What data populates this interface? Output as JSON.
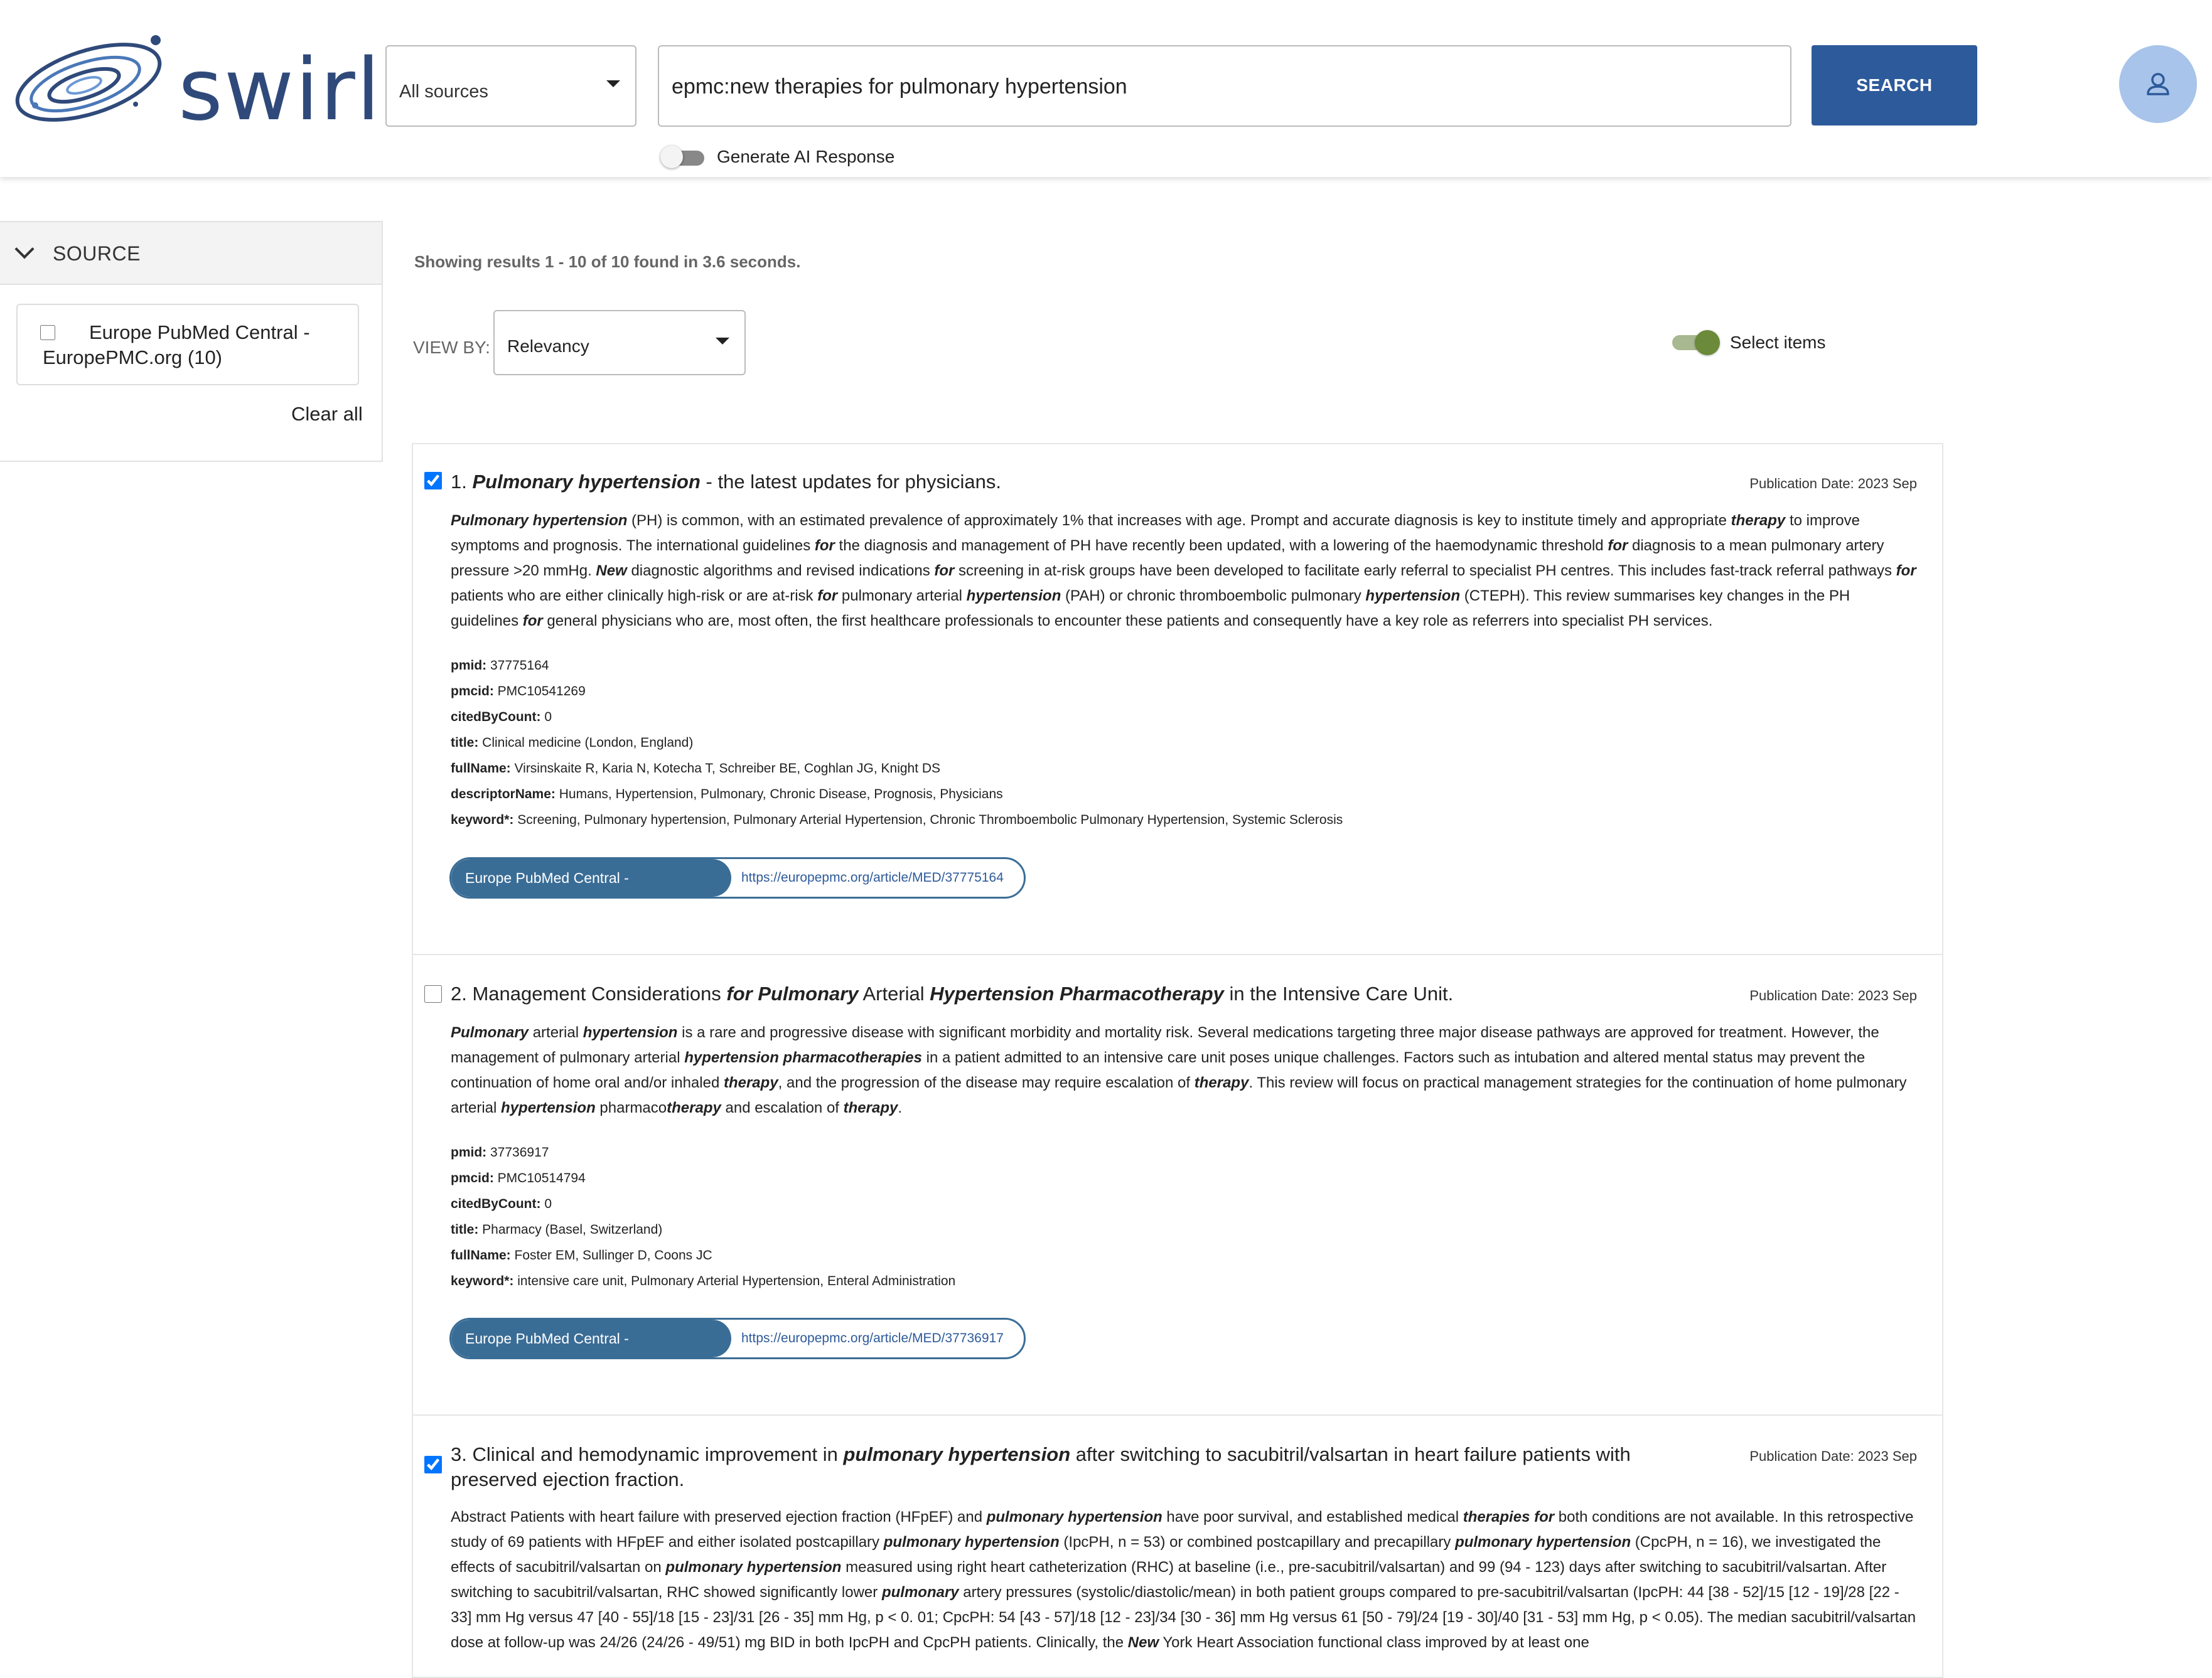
{
  "header": {
    "logo_text": "swirl",
    "source_select": "All sources",
    "search_value": "epmc:new therapies for pulmonary hypertension",
    "search_button": "SEARCH",
    "ai_label": "Generate AI Response"
  },
  "sidebar": {
    "title": "SOURCE",
    "facet_label": "Europe PubMed Central - EuropePMC.org (10)",
    "clear_all": "Clear all"
  },
  "results_meta": {
    "showing": "Showing results 1 - 10 of 10 found in 3.6 seconds.",
    "viewby_label": "VIEW BY:",
    "viewby_value": "Relevancy",
    "select_items": "Select items"
  },
  "results": [
    {
      "checked": true,
      "date": "Publication Date: 2023 Sep",
      "title_parts": [
        {
          "t": "1. ",
          "b": false
        },
        {
          "t": "Pulmonary hypertension",
          "b": true
        },
        {
          "t": " - the latest updates for physicians.",
          "b": false
        }
      ],
      "abstract_parts": [
        {
          "t": "Pulmonary hypertension",
          "b": true
        },
        {
          "t": " (PH) is common, with an estimated prevalence of approximately 1% that increases with age. Prompt and accurate diagnosis is key to institute timely and appropriate ",
          "b": false
        },
        {
          "t": "therapy",
          "b": true
        },
        {
          "t": " to improve symptoms and prognosis. The international guidelines ",
          "b": false
        },
        {
          "t": "for",
          "b": true
        },
        {
          "t": " the diagnosis and management of PH have recently been updated, with a lowering of the haemodynamic threshold ",
          "b": false
        },
        {
          "t": "for",
          "b": true
        },
        {
          "t": " diagnosis to a mean pulmonary artery pressure >20 mmHg. ",
          "b": false
        },
        {
          "t": "New",
          "b": true
        },
        {
          "t": " diagnostic algorithms and revised indications ",
          "b": false
        },
        {
          "t": "for",
          "b": true
        },
        {
          "t": " screening in at-risk groups have been developed to facilitate early referral to specialist PH centres. This includes fast-track referral pathways ",
          "b": false
        },
        {
          "t": "for",
          "b": true
        },
        {
          "t": " patients who are either clinically high-risk or are at-risk ",
          "b": false
        },
        {
          "t": "for",
          "b": true
        },
        {
          "t": " pulmonary arterial ",
          "b": false
        },
        {
          "t": "hypertension",
          "b": true
        },
        {
          "t": " (PAH) or chronic thromboembolic pulmonary ",
          "b": false
        },
        {
          "t": "hypertension",
          "b": true
        },
        {
          "t": " (CTEPH). This review summarises key changes in the PH guidelines ",
          "b": false
        },
        {
          "t": "for",
          "b": true
        },
        {
          "t": " general physicians who are, most often, the first healthcare professionals to encounter these patients and consequently have a key role as referrers into specialist PH services.",
          "b": false
        }
      ],
      "meta": [
        {
          "k": "pmid:",
          "v": " 37775164"
        },
        {
          "k": "pmcid:",
          "v": " PMC10541269"
        },
        {
          "k": "citedByCount:",
          "v": " 0"
        },
        {
          "k": "title:",
          "v": " Clinical medicine (London, England)"
        },
        {
          "k": "fullName:",
          "v": " Virsinskaite R, Karia N, Kotecha T, Schreiber BE, Coghlan JG, Knight DS"
        },
        {
          "k": "descriptorName:",
          "v": " Humans, Hypertension, Pulmonary, Chronic Disease, Prognosis, Physicians"
        },
        {
          "k": "keyword*:",
          "v": " Screening, Pulmonary hypertension, Pulmonary Arterial Hypertension, Chronic Thromboembolic Pulmonary Hypertension, Systemic Sclerosis"
        }
      ],
      "source_label": "Europe PubMed Central - EuropePMC.org",
      "url": "https://europepmc.org/article/MED/37775164"
    },
    {
      "checked": false,
      "date": "Publication Date: 2023 Sep",
      "title_parts": [
        {
          "t": "2. Management Considerations ",
          "b": false
        },
        {
          "t": "for Pulmonary",
          "b": true
        },
        {
          "t": " Arterial ",
          "b": false
        },
        {
          "t": "Hypertension Pharmacotherapy",
          "b": true
        },
        {
          "t": " in the Intensive Care Unit.",
          "b": false
        }
      ],
      "abstract_parts": [
        {
          "t": "Pulmonary",
          "b": true
        },
        {
          "t": " arterial ",
          "b": false
        },
        {
          "t": "hypertension",
          "b": true
        },
        {
          "t": " is a rare and progressive disease with significant morbidity and mortality risk. Several medications targeting three major disease pathways are approved for treatment. However, the management of pulmonary arterial ",
          "b": false
        },
        {
          "t": "hypertension pharmacotherapies",
          "b": true
        },
        {
          "t": " in a patient admitted to an intensive care unit poses unique challenges. Factors such as intubation and altered mental status may prevent the continuation of home oral and/or inhaled ",
          "b": false
        },
        {
          "t": "therapy",
          "b": true
        },
        {
          "t": ", and the progression of the disease may require escalation of ",
          "b": false
        },
        {
          "t": "therapy",
          "b": true
        },
        {
          "t": ". This review will focus on practical management strategies for the continuation of home pulmonary arterial ",
          "b": false
        },
        {
          "t": "hypertension",
          "b": true
        },
        {
          "t": " pharmaco",
          "b": false
        },
        {
          "t": "therapy",
          "b": true
        },
        {
          "t": " and escalation of ",
          "b": false
        },
        {
          "t": "therapy",
          "b": true
        },
        {
          "t": ".",
          "b": false
        }
      ],
      "meta": [
        {
          "k": "pmid:",
          "v": " 37736917"
        },
        {
          "k": "pmcid:",
          "v": " PMC10514794"
        },
        {
          "k": "citedByCount:",
          "v": " 0"
        },
        {
          "k": "title:",
          "v": " Pharmacy (Basel, Switzerland)"
        },
        {
          "k": "fullName:",
          "v": " Foster EM, Sullinger D, Coons JC"
        },
        {
          "k": "keyword*:",
          "v": " intensive care unit, Pulmonary Arterial Hypertension, Enteral Administration"
        }
      ],
      "source_label": "Europe PubMed Central - EuropePMC.org",
      "url": "https://europepmc.org/article/MED/37736917"
    },
    {
      "checked": true,
      "date": "Publication Date: 2023 Sep",
      "title_parts": [
        {
          "t": "3. Clinical and hemodynamic improvement in ",
          "b": false
        },
        {
          "t": "pulmonary hypertension",
          "b": true
        },
        {
          "t": " after switching to sacubitril/valsartan in heart failure patients with preserved ejection fraction.",
          "b": false
        }
      ],
      "abstract_parts": [
        {
          "t": "Abstract Patients with heart failure with preserved ejection fraction (HFpEF) and ",
          "b": false
        },
        {
          "t": "pulmonary hypertension",
          "b": true
        },
        {
          "t": " have poor survival, and established medical ",
          "b": false
        },
        {
          "t": "therapies for",
          "b": true
        },
        {
          "t": " both conditions are not available. In this retrospective study of 69 patients with HFpEF and either isolated postcapillary ",
          "b": false
        },
        {
          "t": "pulmonary hypertension",
          "b": true
        },
        {
          "t": " (IpcPH, n = 53) or combined postcapillary and precapillary ",
          "b": false
        },
        {
          "t": "pulmonary hypertension",
          "b": true
        },
        {
          "t": " (CpcPH, n = 16), we investigated the effects of sacubitril/valsartan on ",
          "b": false
        },
        {
          "t": "pulmonary hypertension",
          "b": true
        },
        {
          "t": " measured using right heart catheterization (RHC) at baseline (i.e., pre-sacubitril/valsartan) and 99 (94 - 123) days after switching to sacubitril/valsartan. After switching to sacubitril/valsartan, RHC showed significantly lower ",
          "b": false
        },
        {
          "t": "pulmonary",
          "b": true
        },
        {
          "t": " artery pressures (systolic/diastolic/mean) in both patient groups compared to pre-sacubitril/valsartan (IpcPH: 44 [38 - 52]/15 [12 - 19]/28 [22 - 33] mm Hg versus 47 [40 - 55]/18 [15 - 23]/31 [26 - 35] mm Hg, p < 0. 01; CpcPH: 54 [43 - 57]/18 [12 - 23]/34 [30 - 36] mm Hg versus 61 [50 - 79]/24 [19 - 30]/40 [31 - 53] mm Hg, p < 0.05). The median sacubitril/valsartan dose at follow-up was 24/26 (24/26 - 49/51) mg BID in both IpcPH and CpcPH patients. Clinically, the ",
          "b": false
        },
        {
          "t": "New",
          "b": true
        },
        {
          "t": " York Heart Association functional class improved by at least one",
          "b": false
        }
      ],
      "meta": [],
      "source_label": "",
      "url": ""
    }
  ]
}
